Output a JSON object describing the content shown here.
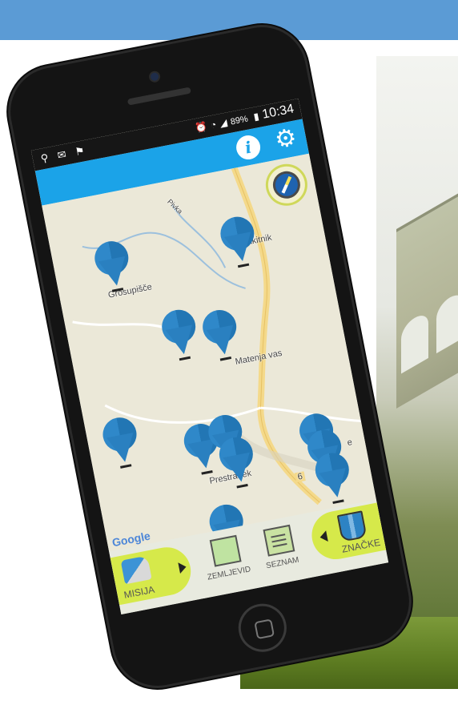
{
  "status_bar": {
    "icons_left": [
      "location-icon",
      "mail-icon",
      "notification-icon"
    ],
    "icons_right": [
      "alarm-icon",
      "wifi-icon",
      "signal-icon",
      "battery-icon"
    ],
    "battery": "89%",
    "time": "10:34"
  },
  "app_bar": {
    "info_glyph": "i",
    "settings_glyph": "⚙"
  },
  "map": {
    "labels": {
      "p1": "Grosupišče",
      "p2": "Prakitnik",
      "p3": "Matenja vas",
      "p4": "Prestranek",
      "p5": "e",
      "road": "6",
      "river": "Pivka"
    },
    "google": "Google"
  },
  "bottom_nav": {
    "misija": "MISIJA",
    "zemljevid": "ZEMLJEVID",
    "seznam": "SEZNAM",
    "znacke": "ZNAČKE"
  },
  "colors": {
    "app_bar": "#1ba3e8",
    "pin": "#2d83c4",
    "accent_green": "#d6e94a",
    "banner": "#5b9bd5"
  }
}
